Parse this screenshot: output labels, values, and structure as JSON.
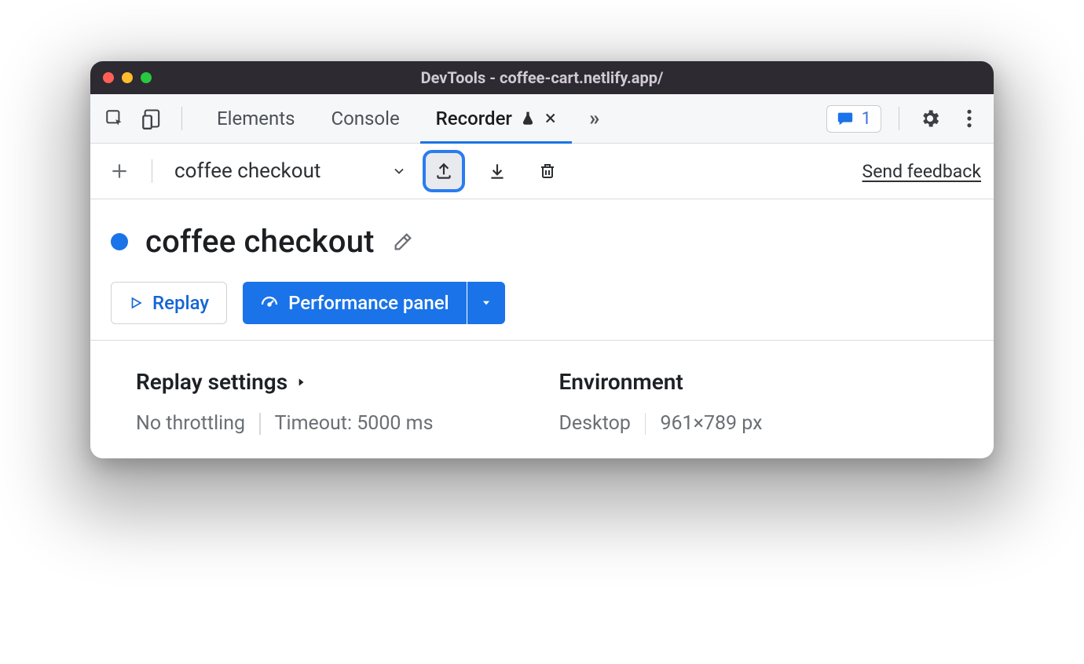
{
  "window_title": "DevTools - coffee-cart.netlify.app/",
  "tabs": {
    "elements": "Elements",
    "console": "Console",
    "recorder": "Recorder"
  },
  "issues_badge": "1",
  "toolbar": {
    "recording_name": "coffee checkout",
    "feedback_link": "Send feedback"
  },
  "recording": {
    "title": "coffee checkout",
    "replay_label": "Replay",
    "performance_label": "Performance panel"
  },
  "replay_settings": {
    "heading": "Replay settings",
    "throttling": "No throttling",
    "timeout": "Timeout: 5000 ms"
  },
  "environment": {
    "heading": "Environment",
    "device": "Desktop",
    "viewport": "961×789 px"
  }
}
